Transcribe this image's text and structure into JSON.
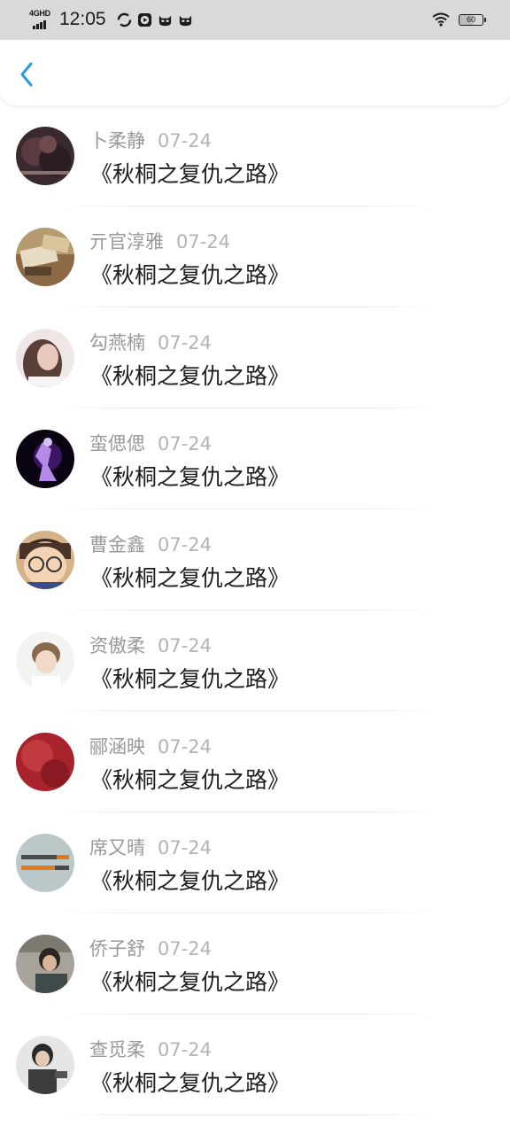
{
  "status_bar": {
    "network": "4GHD",
    "time": "12:05",
    "battery": "60",
    "icons": [
      "sync-icon",
      "play-icon",
      "cat-icon",
      "cat-icon",
      "wifi-icon",
      "battery-icon"
    ]
  },
  "header": {
    "back_icon": "chevron-left-icon",
    "accent_color": "#2b9be0"
  },
  "items": [
    {
      "name": "卜柔静",
      "date": "07-24",
      "title": "《秋桐之复仇之路》"
    },
    {
      "name": "亓官淳雅",
      "date": "07-24",
      "title": "《秋桐之复仇之路》"
    },
    {
      "name": "勾燕楠",
      "date": "07-24",
      "title": "《秋桐之复仇之路》"
    },
    {
      "name": "蛮偲偲",
      "date": "07-24",
      "title": "《秋桐之复仇之路》"
    },
    {
      "name": "曹金鑫",
      "date": "07-24",
      "title": "《秋桐之复仇之路》"
    },
    {
      "name": "资傲柔",
      "date": "07-24",
      "title": "《秋桐之复仇之路》"
    },
    {
      "name": "郦涵映",
      "date": "07-24",
      "title": "《秋桐之复仇之路》"
    },
    {
      "name": "席又晴",
      "date": "07-24",
      "title": "《秋桐之复仇之路》"
    },
    {
      "name": "侨子舒",
      "date": "07-24",
      "title": "《秋桐之复仇之路》"
    },
    {
      "name": "查觅柔",
      "date": "07-24",
      "title": "《秋桐之复仇之路》"
    }
  ]
}
